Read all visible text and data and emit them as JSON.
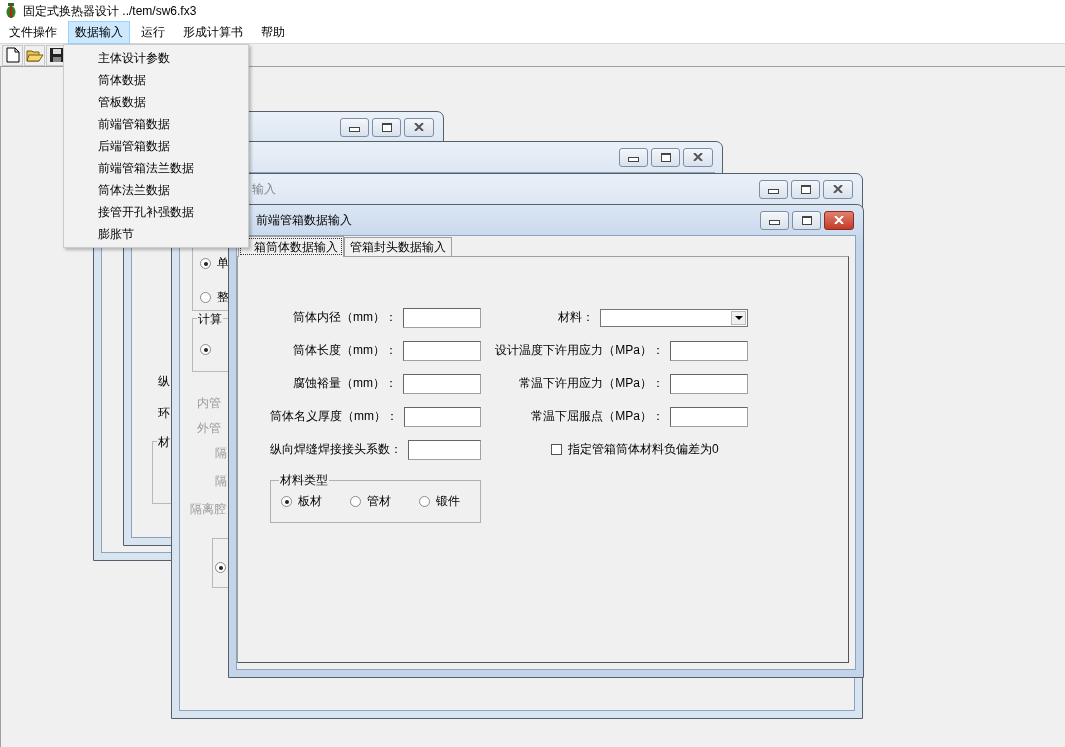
{
  "app_window": {
    "title": "固定式换热器设计 ../tem/sw6.fx3"
  },
  "menu_bar": [
    {
      "label": "文件操作",
      "selected": false
    },
    {
      "label": "数据输入",
      "selected": true
    },
    {
      "label": "运行",
      "selected": false
    },
    {
      "label": "形成计算书",
      "selected": false
    },
    {
      "label": "帮助",
      "selected": false
    }
  ],
  "open_menu": {
    "items": [
      "主体设计参数",
      "筒体数据",
      "管板数据",
      "前端管箱数据",
      "后端管箱数据",
      "前端管箱法兰数据",
      "筒体法兰数据",
      "接管开孔补强数据",
      "膨胀节"
    ]
  },
  "mdi_windows": [
    {
      "active": false
    },
    {
      "active": false,
      "items": [
        {
          "kind": "label",
          "text": "纵",
          "disabled": false
        },
        {
          "kind": "label",
          "text": "环",
          "disabled": false
        },
        {
          "kind": "group",
          "label": "材"
        }
      ]
    },
    {
      "active": false,
      "title": "输入",
      "items": [
        {
          "kind": "group"
        },
        {
          "kind": "radio",
          "label": "单",
          "selected": true
        },
        {
          "kind": "radio",
          "label": "整",
          "selected": false
        },
        {
          "kind": "group",
          "label": "计算"
        },
        {
          "kind": "radio",
          "selected": true
        },
        {
          "kind": "label",
          "text": "内管",
          "disabled": true
        },
        {
          "kind": "label",
          "text": "外管",
          "disabled": true
        },
        {
          "kind": "label",
          "text": "隔",
          "disabled": true
        },
        {
          "kind": "label",
          "text": "隔",
          "disabled": true
        },
        {
          "kind": "label",
          "text": "隔离腔",
          "disabled": true
        },
        {
          "kind": "group"
        },
        {
          "kind": "radio",
          "selected": true
        }
      ]
    }
  ],
  "active_window": {
    "active": true,
    "title": "前端管箱数据输入",
    "tabs": [
      {
        "label": "箱筒体数据输入",
        "selected": true
      },
      {
        "label": "管箱封头数据输入",
        "selected": false
      }
    ],
    "left_fields": [
      {
        "label": "筒体内径（mm）："
      },
      {
        "label": "筒体长度（mm）："
      },
      {
        "label": "腐蚀裕量（mm）："
      },
      {
        "label": "筒体名义厚度（mm）："
      },
      {
        "label": "纵向焊缝焊接接头系数："
      }
    ],
    "right_fields": [
      {
        "kind": "dropdown",
        "label": "材料："
      },
      {
        "kind": "input",
        "label": "设计温度下许用应力（MPa）："
      },
      {
        "kind": "input",
        "label": "常温下许用应力（MPa）："
      },
      {
        "kind": "input",
        "label": "常温下屈服点（MPa）："
      }
    ],
    "checkbox": {
      "label": "指定管箱筒体材料负偏差为0",
      "checked": false
    },
    "material_type": {
      "label": "材料类型",
      "options": [
        {
          "label": "板材",
          "selected": true
        },
        {
          "label": "管材",
          "selected": false
        },
        {
          "label": "锻件",
          "selected": false
        }
      ]
    }
  }
}
